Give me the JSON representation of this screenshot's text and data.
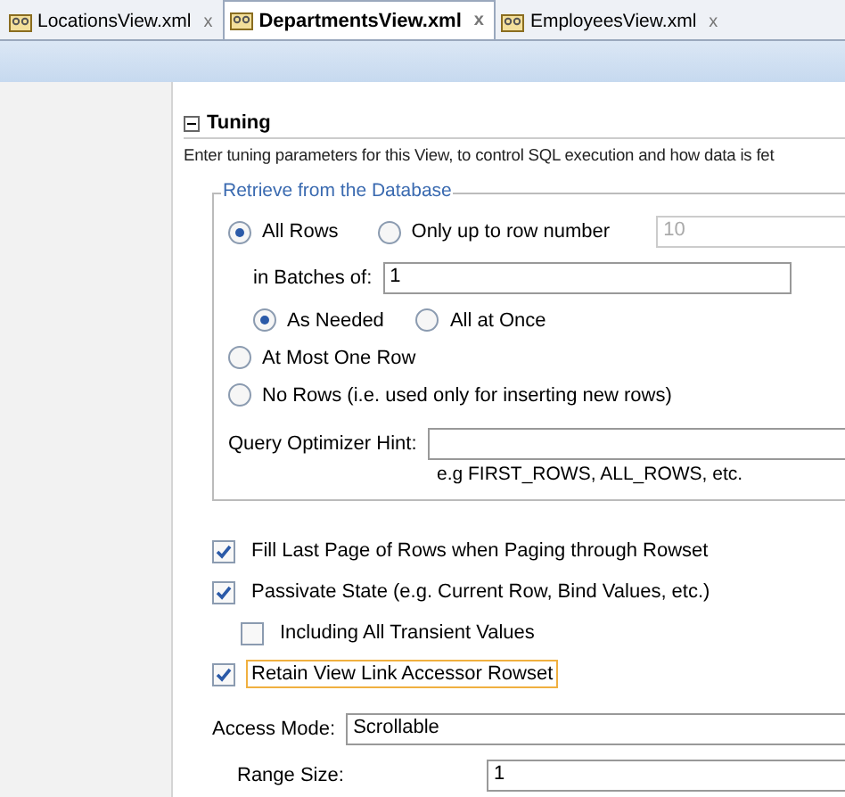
{
  "tabs": [
    {
      "label": "LocationsView.xml",
      "selected": false,
      "close": "x"
    },
    {
      "label": "DepartmentsView.xml",
      "selected": true,
      "close": "x"
    },
    {
      "label": "EmployeesView.xml",
      "selected": false,
      "close": "x"
    }
  ],
  "section": {
    "title": "Tuning",
    "expanded": true,
    "description": "Enter tuning parameters for this View, to control SQL execution and how data is fet"
  },
  "retrieve": {
    "title": "Retrieve from the Database",
    "all_rows": {
      "label": "All Rows",
      "selected": true
    },
    "up_to": {
      "label": "Only up to row number",
      "selected": false,
      "value": "10",
      "disabled": true
    },
    "batches": {
      "label": "in Batches of:",
      "value": "1"
    },
    "fetch": [
      {
        "label": "As Needed",
        "selected": true
      },
      {
        "label": "All at Once",
        "selected": false
      }
    ],
    "at_most_one": {
      "label": "At Most One Row",
      "selected": false
    },
    "no_rows": {
      "label": "No Rows (i.e. used only for inserting new rows)",
      "selected": false
    },
    "hint": {
      "label": "Query Optimizer Hint:",
      "example": "e.g FIRST_ROWS, ALL_ROWS, etc."
    }
  },
  "options": [
    {
      "label": "Fill Last Page of Rows when Paging through Rowset",
      "checked": true,
      "indented": false,
      "focused": false
    },
    {
      "label": "Passivate State (e.g. Current Row, Bind Values, etc.)",
      "checked": true,
      "indented": false,
      "focused": false
    },
    {
      "label": "Including All Transient Values",
      "checked": false,
      "indented": true,
      "focused": false
    },
    {
      "label": "Retain View Link Accessor Rowset",
      "checked": true,
      "indented": false,
      "focused": true
    }
  ],
  "access_mode": {
    "label": "Access Mode:",
    "value": "Scrollable"
  },
  "range_size": {
    "label": "Range Size:",
    "value": "1"
  }
}
